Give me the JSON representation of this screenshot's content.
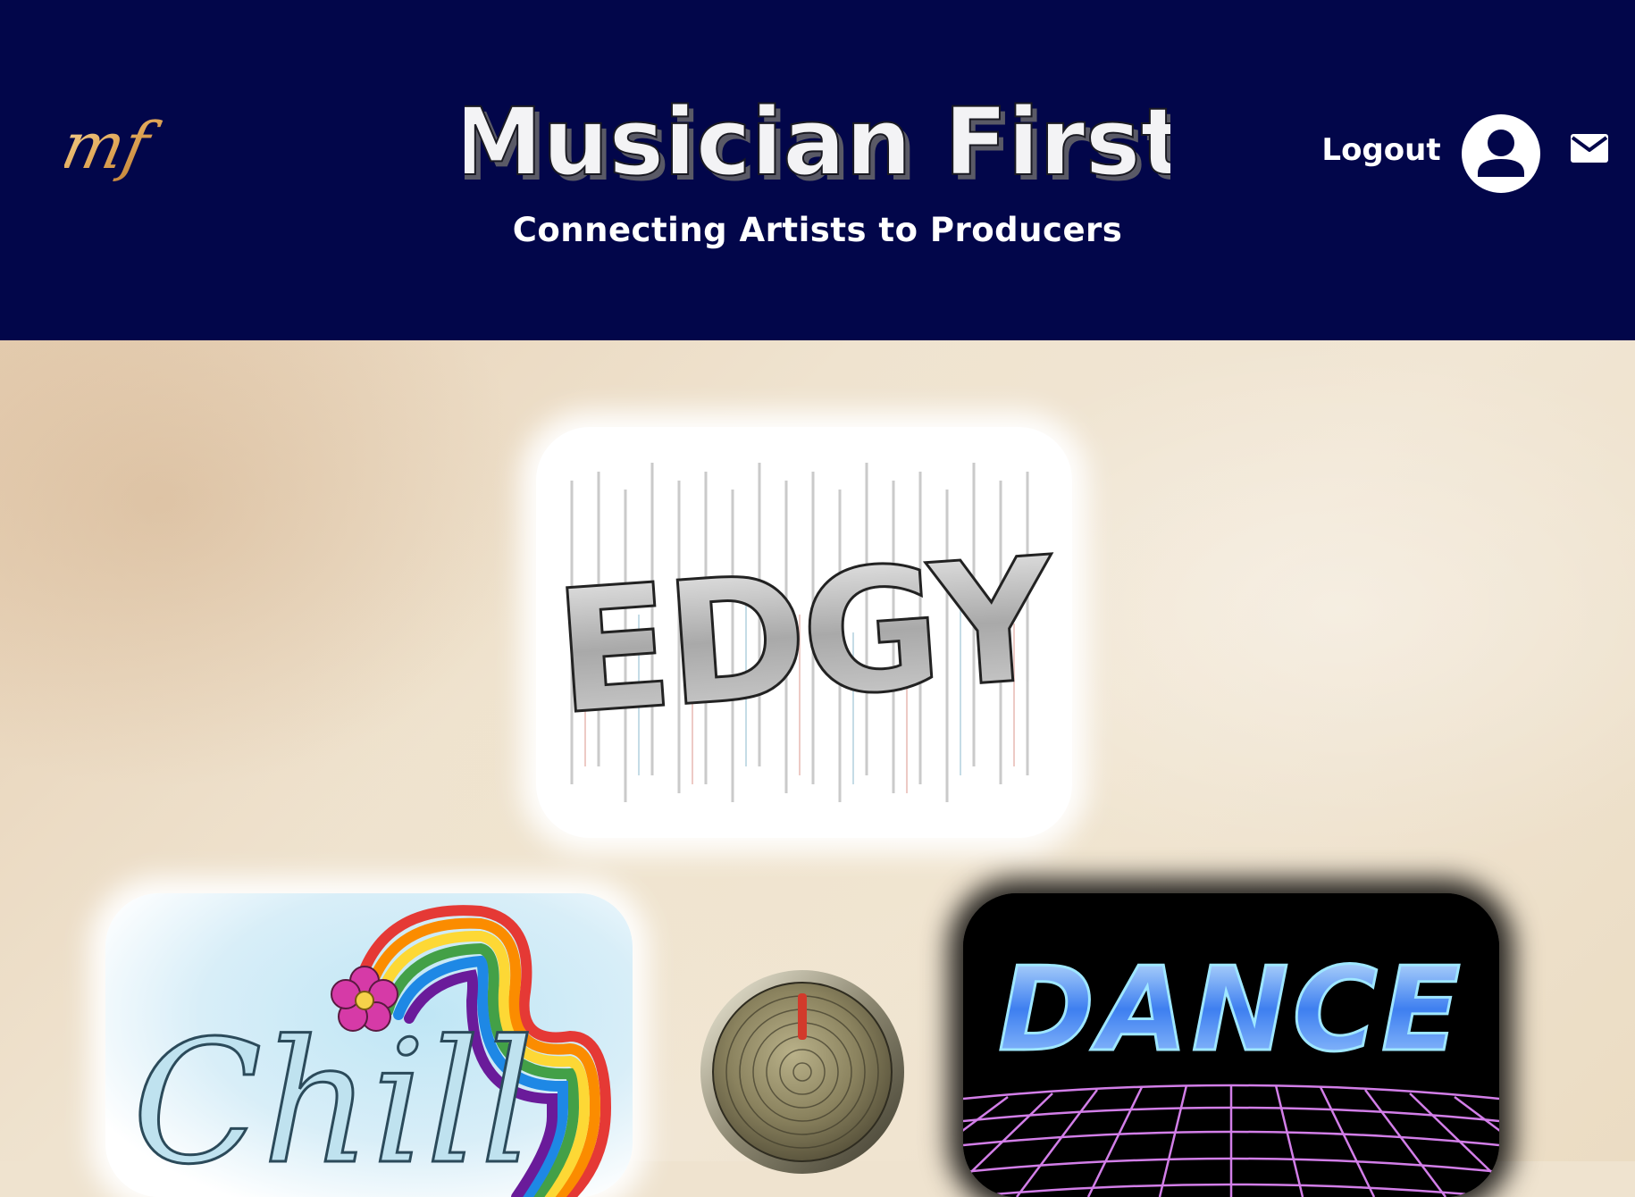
{
  "header": {
    "logo_monogram": "mf",
    "site_title": "Musician First",
    "subtitle": "Connecting Artists to Producers",
    "logout_label": "Logout",
    "background_color": "#02064a",
    "accent_gold": "#e7b96a"
  },
  "icons": {
    "account": "account-circle-icon",
    "mail": "mail-icon"
  },
  "genres": [
    {
      "label": "EDGY",
      "style": "sketched metallic"
    },
    {
      "label": "Chill",
      "style": "watercolor rainbow"
    },
    {
      "label": "DANCE",
      "style": "neon retro grid"
    }
  ],
  "knob": {
    "name": "volume-knob"
  }
}
